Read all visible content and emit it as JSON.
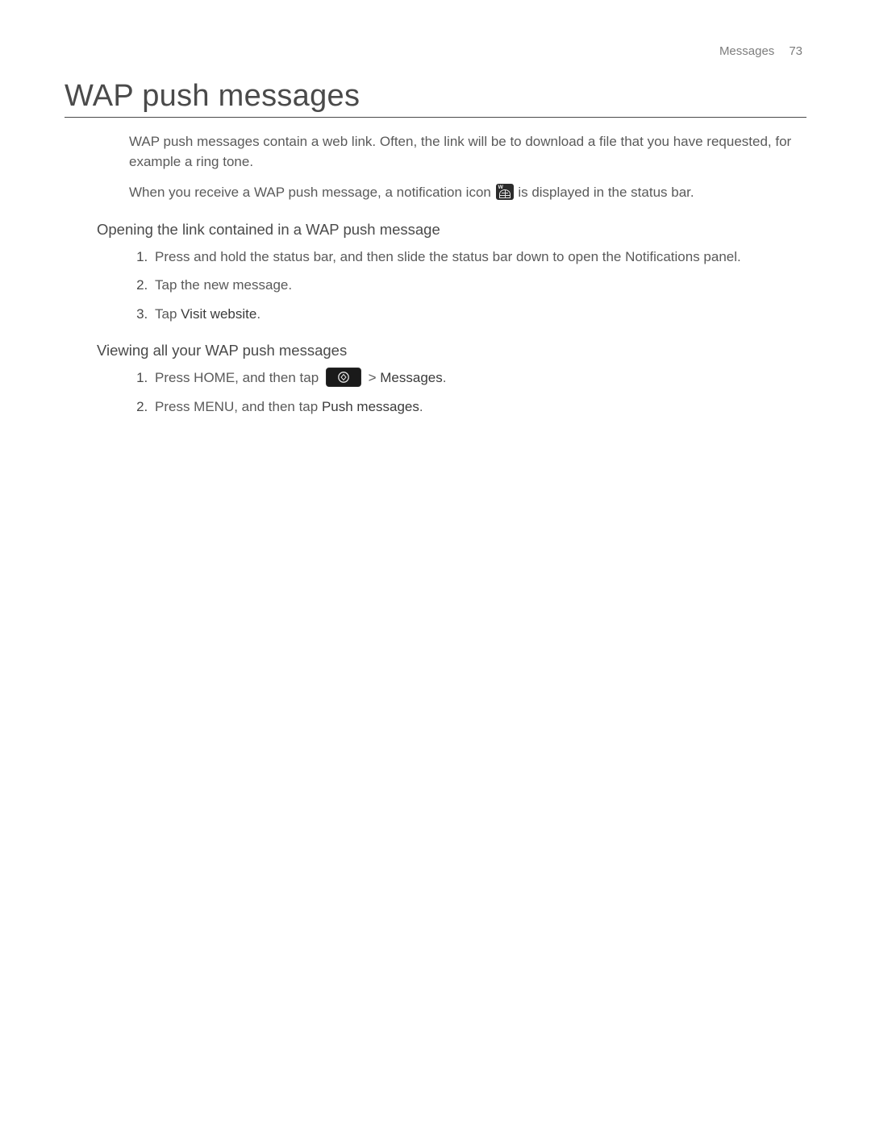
{
  "header": {
    "section": "Messages",
    "page_number": "73"
  },
  "title": "WAP push messages",
  "intro": {
    "p1": "WAP push messages contain a web link. Often, the link will be to download a file that you have requested, for example a ring tone.",
    "p2_before": "When you receive a WAP push message, a notification icon ",
    "p2_after": " is displayed in the status bar."
  },
  "section_open": {
    "heading": "Opening the link contained in a WAP push message",
    "steps": {
      "s1": "Press and hold the status bar, and then slide the status bar down to open the Notifications panel.",
      "s2": "Tap the new message.",
      "s3_before": "Tap ",
      "s3_bold": "Visit website",
      "s3_after": "."
    }
  },
  "section_view": {
    "heading": "Viewing all your WAP push messages",
    "steps": {
      "s1_before": "Press HOME, and then tap ",
      "s1_mid": "  > ",
      "s1_bold": "Messages",
      "s1_after": ".",
      "s2_before": "Press MENU, and then tap ",
      "s2_bold": "Push messages",
      "s2_after": "."
    }
  }
}
